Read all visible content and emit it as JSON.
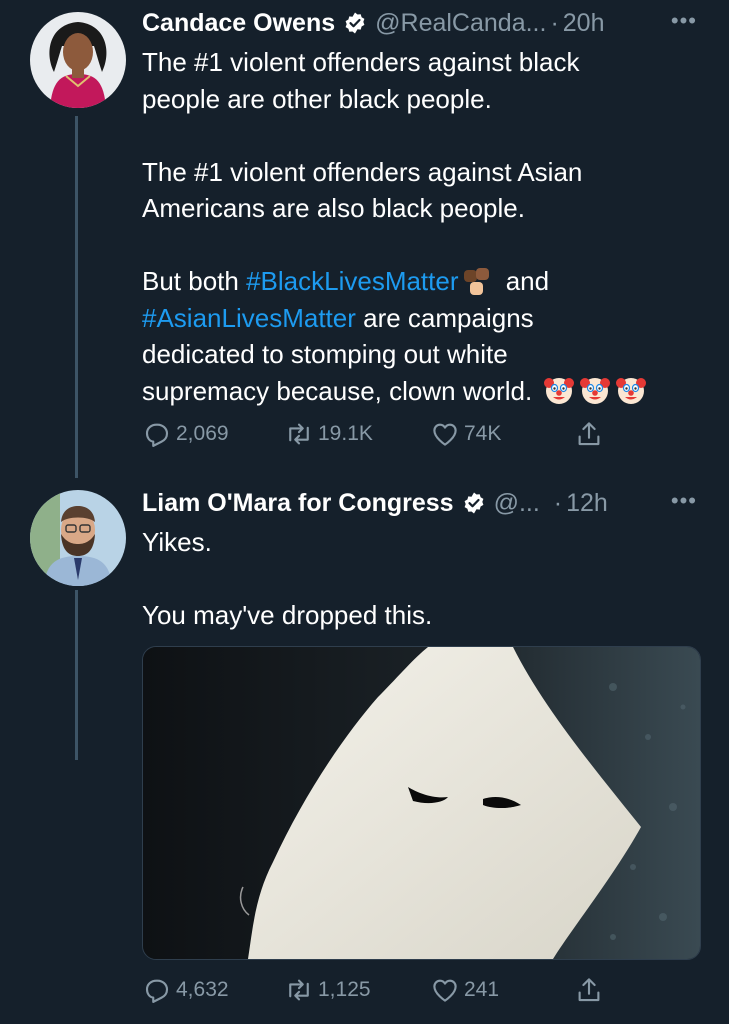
{
  "tweets": [
    {
      "name": "Candace Owens",
      "handle": "@RealCanda...",
      "separator": "·",
      "time": "20h",
      "more": "•••",
      "paragraphs": {
        "p1_line1": "The #1 violent offenders against black",
        "p1_line2": "people are other black people.",
        "p2_line1": "The #1 violent offenders against Asian",
        "p2_line2": "Americans are also black people.",
        "p3_pre": "But both ",
        "p3_tag1": "#BlackLivesMatter",
        "p3_mid": " and",
        "p3_tag2": "#AsianLivesMatter",
        "p3_rest1": " are campaigns",
        "p3_line3": "dedicated to stomping out white",
        "p3_line4": "supremacy because, clown world."
      },
      "emojis": [
        "raised-fists-emoji",
        "clown-face-emoji",
        "clown-face-emoji",
        "clown-face-emoji"
      ],
      "stats": {
        "replies": "2,069",
        "retweets": "19.1K",
        "likes": "74K"
      }
    },
    {
      "name": "Liam O'Mara for Congress",
      "handle": "@...",
      "separator": "·",
      "time": "12h",
      "more": "•••",
      "paragraphs": {
        "line1": "Yikes.",
        "line2": "You may've dropped this."
      },
      "media": "white hood photo",
      "stats": {
        "replies": "4,632",
        "retweets": "1,125",
        "likes": "241"
      }
    }
  ],
  "colors": {
    "background": "#15202b",
    "link": "#1d9bf0",
    "muted": "#8899a6",
    "thread_line": "#3d5466",
    "verified": "#ffffff"
  },
  "icons": [
    "reply-icon",
    "retweet-icon",
    "like-icon",
    "share-icon",
    "verified-badge-icon",
    "more-icon"
  ]
}
